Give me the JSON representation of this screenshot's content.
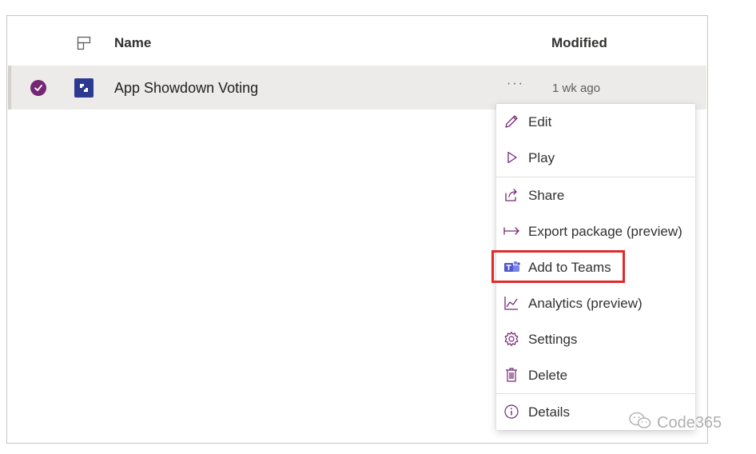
{
  "header": {
    "name_label": "Name",
    "modified_label": "Modified"
  },
  "row": {
    "app_name": "App Showdown Voting",
    "more_label": "···",
    "modified": "1 wk ago"
  },
  "menu": {
    "items": [
      {
        "label": "Edit",
        "icon": "pencil-icon"
      },
      {
        "label": "Play",
        "icon": "play-icon"
      },
      {
        "label": "Share",
        "icon": "share-icon"
      },
      {
        "label": "Export package (preview)",
        "icon": "export-arrow-icon"
      },
      {
        "label": "Add to Teams",
        "icon": "teams-icon"
      },
      {
        "label": "Analytics (preview)",
        "icon": "chart-line-icon"
      },
      {
        "label": "Settings",
        "icon": "gear-icon"
      },
      {
        "label": "Delete",
        "icon": "trash-icon"
      },
      {
        "label": "Details",
        "icon": "info-icon"
      }
    ]
  },
  "watermark": {
    "text": "Code365"
  },
  "colors": {
    "accent": "#742774",
    "app_icon": "#2b3990",
    "highlight": "#e02b2b",
    "row_selected": "#edebe9"
  }
}
